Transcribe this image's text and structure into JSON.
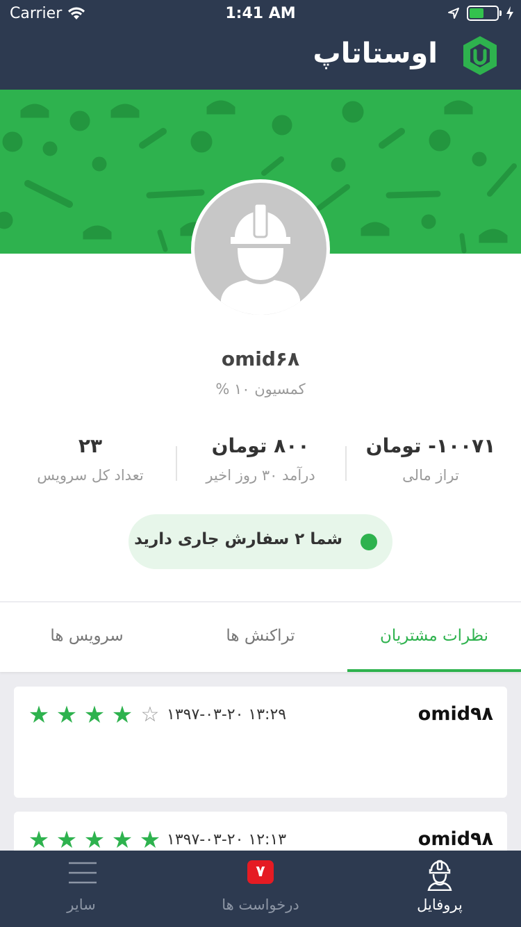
{
  "status_bar": {
    "carrier": "Carrier",
    "time": "1:41 AM"
  },
  "app": {
    "brand_name": "اوستاتاپ"
  },
  "profile": {
    "username": "omid۶۸",
    "commission": "کمسیون ۱۰ %"
  },
  "stats": [
    {
      "value": "۱۰۰۷۱- تومان",
      "label": "تراز مالی"
    },
    {
      "value": "۸۰۰ تومان",
      "label": "درآمد ۳۰ روز اخیر"
    },
    {
      "value": "۲۳",
      "label": "تعداد کل سرویس"
    }
  ],
  "active_orders": {
    "text": "شما ۲ سفارش جاری دارید"
  },
  "tabs": [
    {
      "label": "نظرات مشتریان",
      "active": true
    },
    {
      "label": "تراکنش ها",
      "active": false
    },
    {
      "label": "سرویس ها",
      "active": false
    }
  ],
  "reviews": [
    {
      "name": "omid۹۸",
      "datetime": "۱۳۹۷-۰۳-۲۰ ۱۳:۲۹",
      "rating": 4,
      "max_rating": 5
    },
    {
      "name": "omid۹۸",
      "datetime": "۱۳۹۷-۰۳-۲۰ ۱۲:۱۳",
      "rating": 5,
      "max_rating": 5
    }
  ],
  "bottom_nav": [
    {
      "label": "پروفایل",
      "icon": "worker-icon",
      "active": true
    },
    {
      "label": "درخواست ها",
      "icon": "requests-icon",
      "badge": "۷",
      "active": false
    },
    {
      "label": "سایر",
      "icon": "menu-icon",
      "active": false
    }
  ],
  "colors": {
    "primary_green": "#2eb24e",
    "navy": "#2d3a50",
    "badge_red": "#e51b23"
  }
}
